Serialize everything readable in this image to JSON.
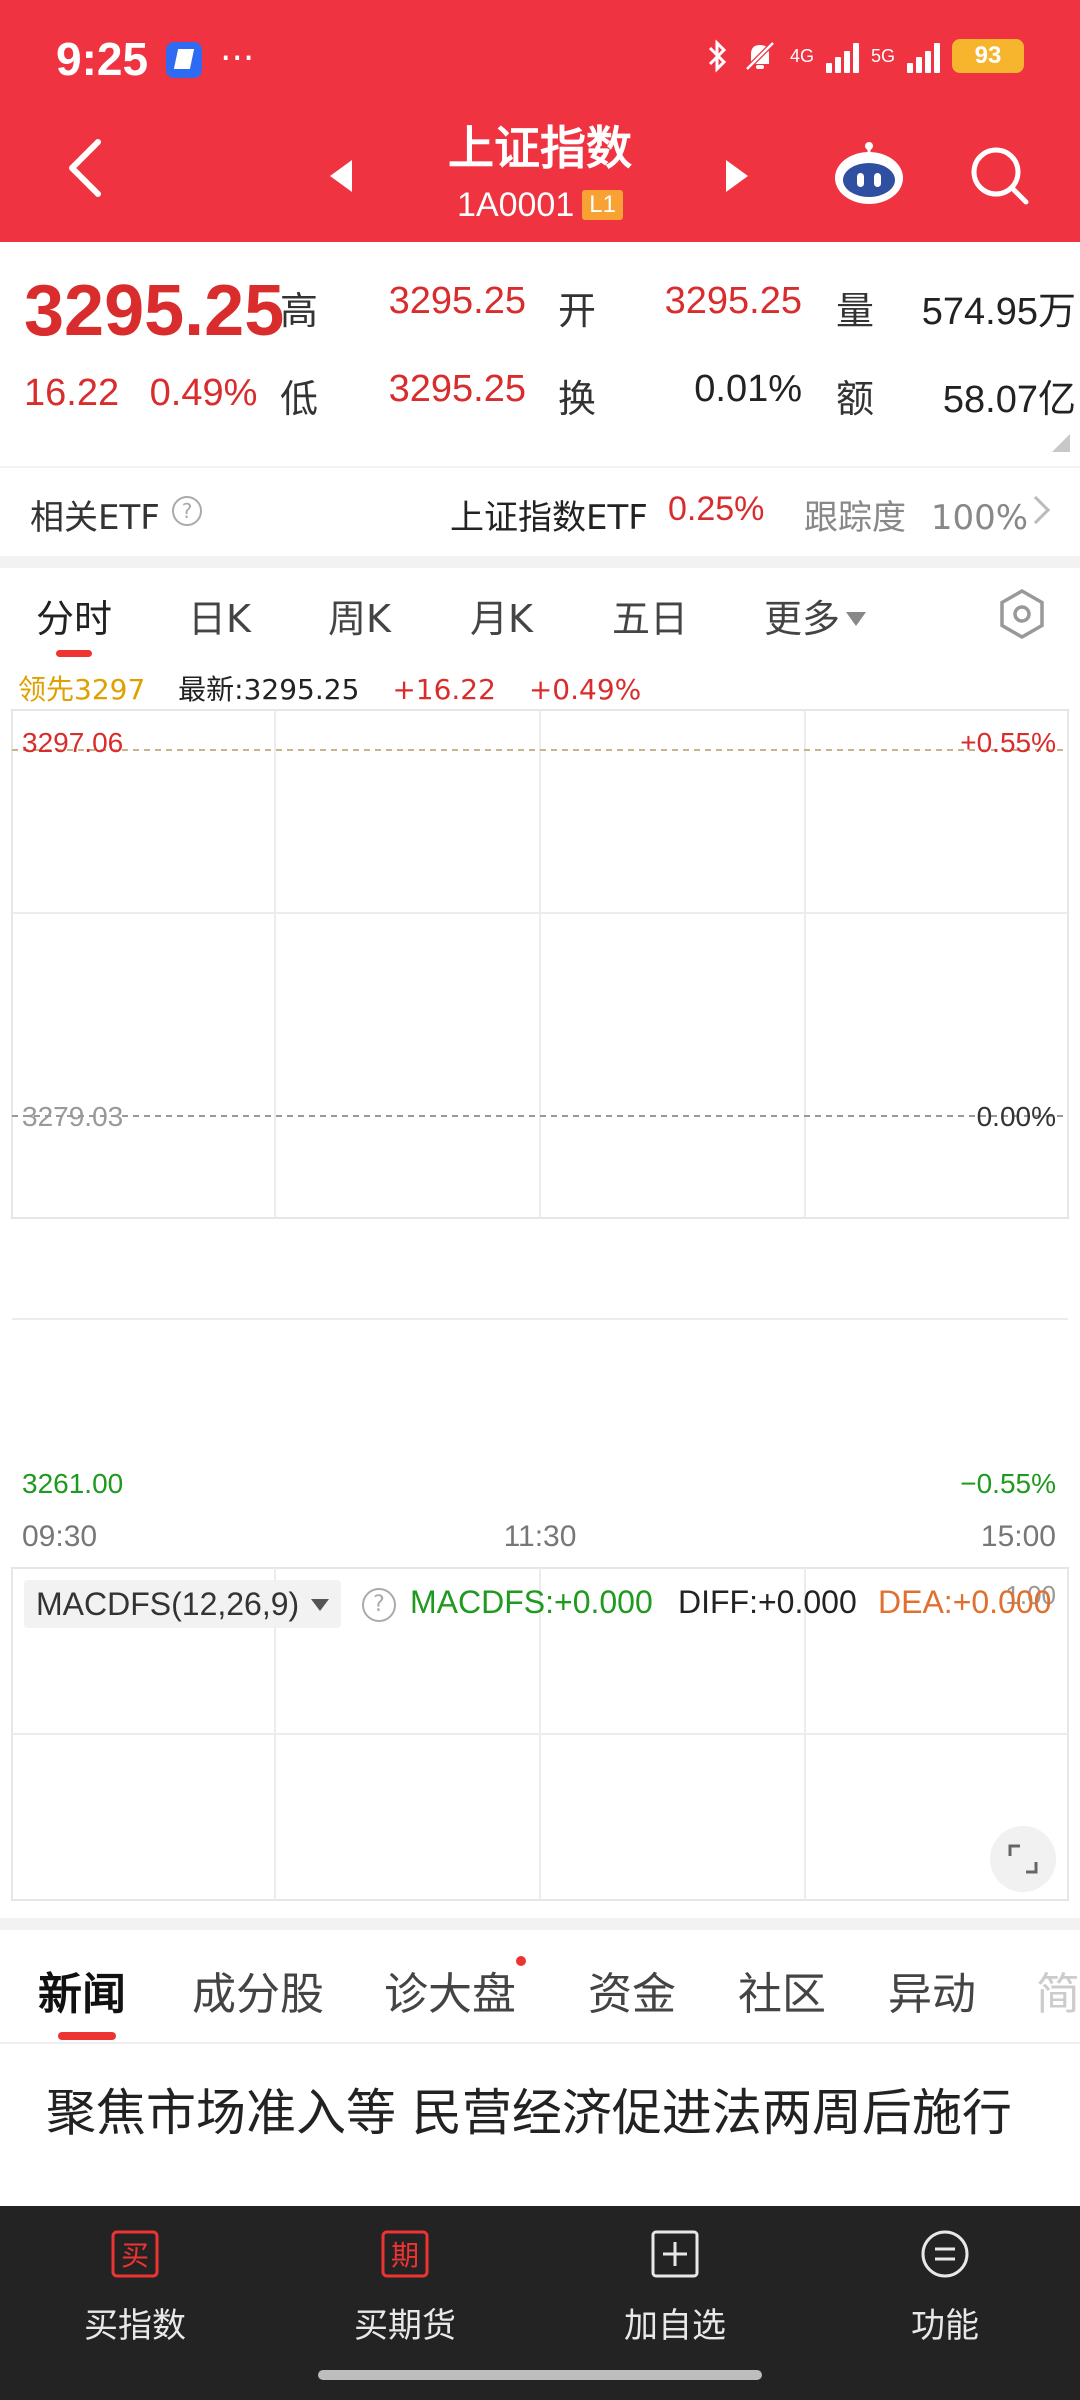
{
  "status_bar": {
    "time": "9:25",
    "dots": "···",
    "network_4g": "4G",
    "network_5g": "5G",
    "battery": "93"
  },
  "nav": {
    "title": "上证指数",
    "code": "1A0001",
    "code_badge": "L1"
  },
  "quote": {
    "price": "3295.25",
    "change_abs": "16.22",
    "change_pct": "0.49%",
    "high_label": "高",
    "high": "3295.25",
    "low_label": "低",
    "low": "3295.25",
    "open_label": "开",
    "open": "3295.25",
    "turnover_label": "换",
    "turnover": "0.01%",
    "volume_label": "量",
    "volume": "574.95万",
    "amount_label": "额",
    "amount": "58.07亿"
  },
  "etf": {
    "label": "相关ETF",
    "name": "上证指数ETF",
    "pct": "0.25%",
    "track_label": "跟踪度",
    "track_value": "100%"
  },
  "period_tabs": [
    "分时",
    "日K",
    "周K",
    "月K",
    "五日",
    "更多"
  ],
  "latest": {
    "leader": "领先3297",
    "latest": "最新:3295.25",
    "change": "+16.22",
    "pct": "+0.49%"
  },
  "chart_data": {
    "type": "line",
    "y_left_ticks": [
      "3297.06",
      "3279.03",
      "3261.00"
    ],
    "y_right_ticks": [
      "+0.55%",
      "0.00%",
      "−0.55%"
    ],
    "x_ticks": [
      "09:30",
      "11:30",
      "15:00"
    ],
    "ylim": [
      3261.0,
      3297.06
    ],
    "prev_close": 3279.03,
    "series": [],
    "macd_axis_label": "1.00"
  },
  "macd": {
    "selector": "MACDFS(12,26,9)",
    "macdfs": "MACDFS:+0.000",
    "diff": "DIFF:+0.000",
    "dea": "DEA:+0.000"
  },
  "news_tabs": [
    "新闻",
    "成分股",
    "诊大盘",
    "资金",
    "社区",
    "异动",
    "简"
  ],
  "headline": "聚焦市场准入等 民营经济促进法两周后施行",
  "bottom_bar": [
    {
      "icon_text": "买",
      "label": "买指数"
    },
    {
      "icon_text": "期",
      "label": "买期货"
    },
    {
      "icon_text": "",
      "label": "加自选"
    },
    {
      "icon_text": "",
      "label": "功能"
    }
  ],
  "colors": {
    "header": "#ef3340",
    "up": "#d92c2c",
    "down": "#1e9a1e",
    "accent_orange": "#e07030"
  }
}
